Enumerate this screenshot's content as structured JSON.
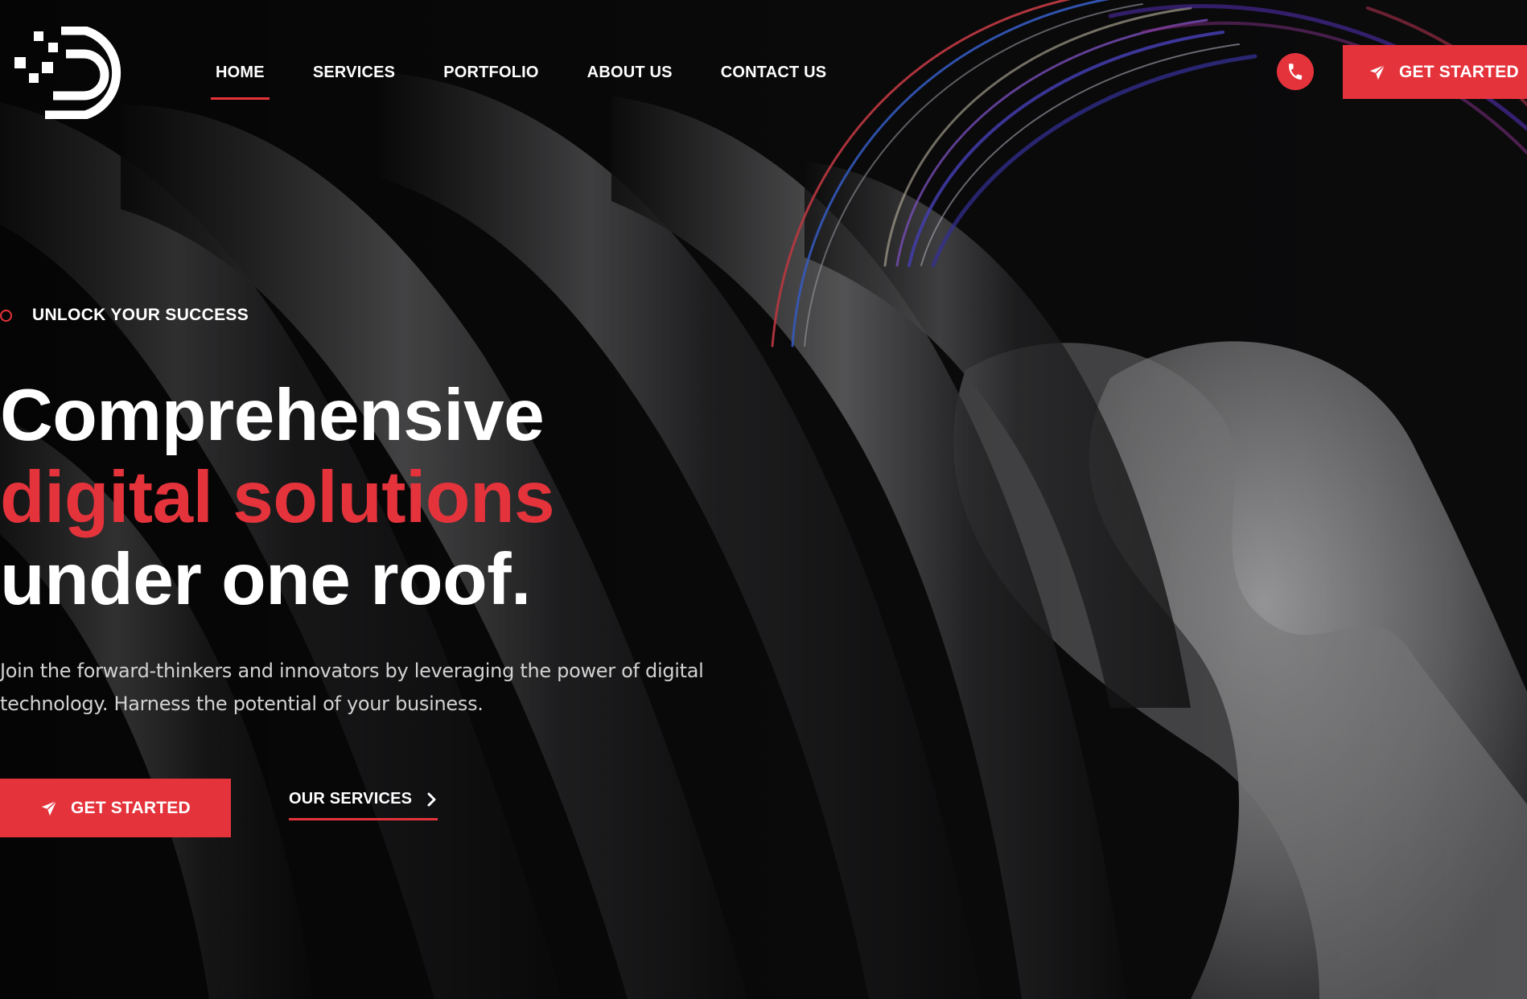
{
  "colors": {
    "accent": "#e5333c",
    "background": "#0b0b0c",
    "text_primary": "#ffffff",
    "text_secondary": "#d2d2d2"
  },
  "header": {
    "logo_icon": "logo-d-mark",
    "nav": [
      {
        "label": "HOME",
        "active": true
      },
      {
        "label": "SERVICES",
        "active": false
      },
      {
        "label": "PORTFOLIO",
        "active": false
      },
      {
        "label": "ABOUT US",
        "active": false
      },
      {
        "label": "CONTACT US",
        "active": false
      }
    ],
    "phone_icon": "phone-icon",
    "cta": {
      "label": "GET STARTED",
      "icon": "paper-plane-icon"
    }
  },
  "hero": {
    "eyebrow": "UNLOCK YOUR SUCCESS",
    "eyebrow_icon": "ring-icon",
    "headline": {
      "line1": "Comprehensive",
      "line2": "digital solutions",
      "line3": "under one roof."
    },
    "subtext": "Join the forward-thinkers and innovators by leveraging the power of digital technology. Harness the potential of your business.",
    "primary_cta": {
      "label": "GET STARTED",
      "icon": "paper-plane-icon"
    },
    "secondary_cta": {
      "label": "OUR SERVICES",
      "icon": "chevron-right-icon"
    }
  }
}
